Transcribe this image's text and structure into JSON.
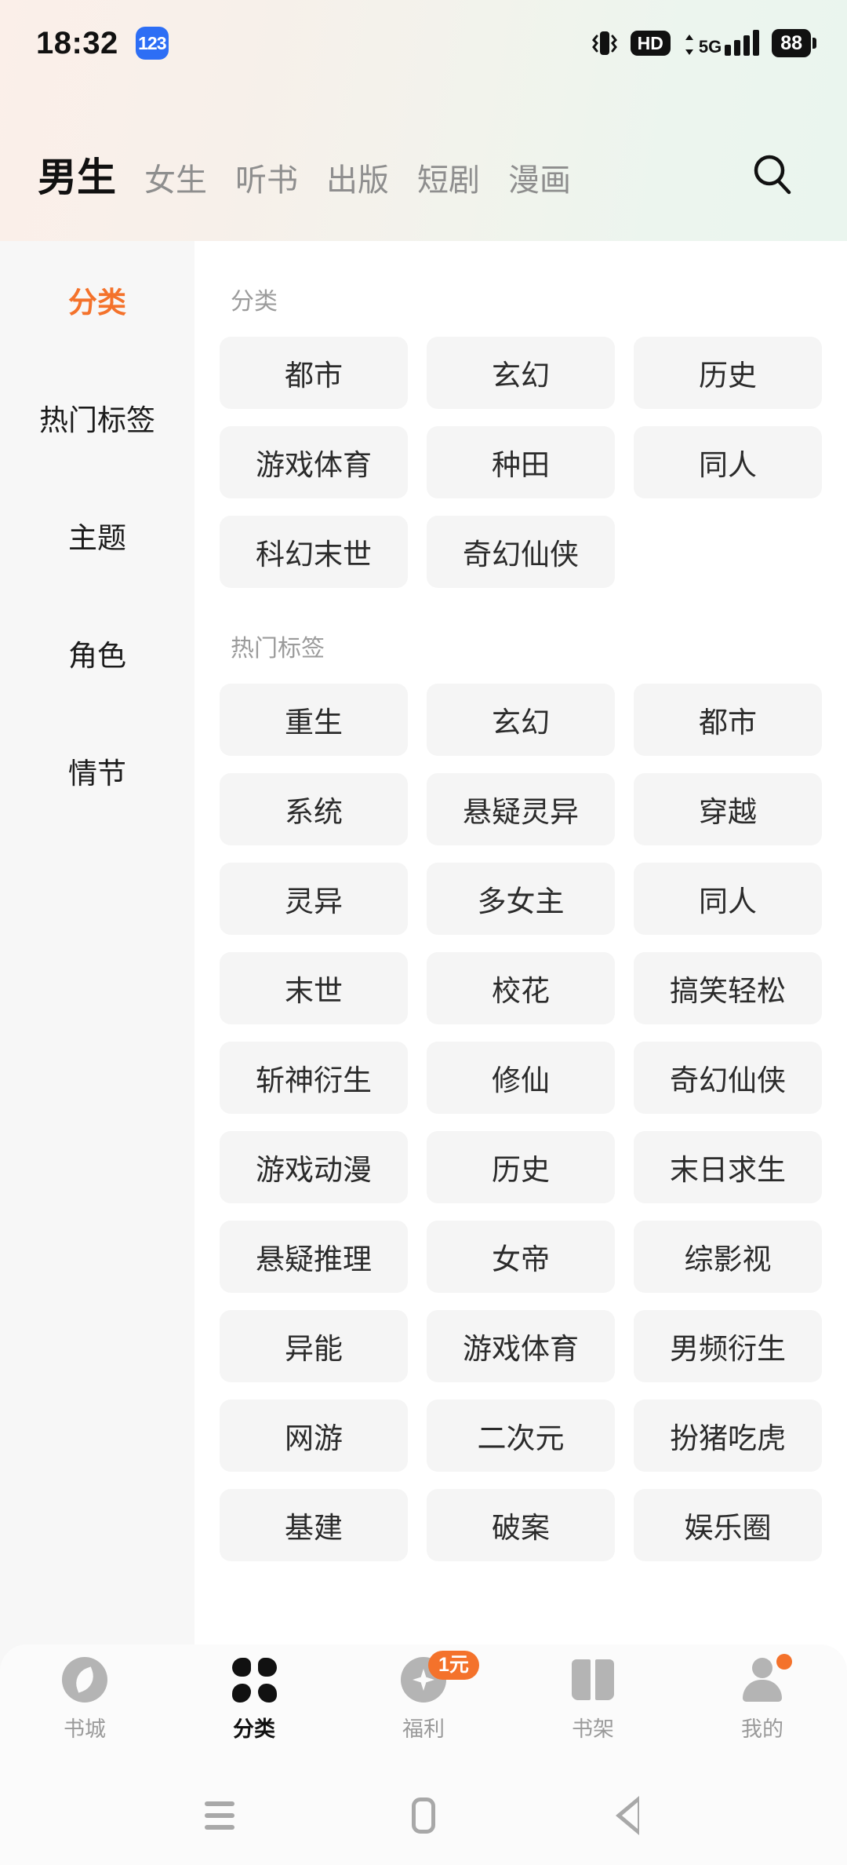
{
  "status_bar": {
    "time": "18:32",
    "app_badge": "123",
    "hd_label": "HD",
    "network_label": "5G",
    "battery_level": "88"
  },
  "top_nav": {
    "tabs": [
      {
        "label": "男生",
        "active": true
      },
      {
        "label": "女生",
        "active": false
      },
      {
        "label": "听书",
        "active": false
      },
      {
        "label": "出版",
        "active": false
      },
      {
        "label": "短剧",
        "active": false
      },
      {
        "label": "漫画",
        "active": false
      }
    ],
    "search_icon": "search-icon"
  },
  "sidebar": {
    "items": [
      {
        "label": "分类",
        "active": true
      },
      {
        "label": "热门标签",
        "active": false
      },
      {
        "label": "主题",
        "active": false
      },
      {
        "label": "角色",
        "active": false
      },
      {
        "label": "情节",
        "active": false
      }
    ]
  },
  "content": {
    "sections": [
      {
        "title": "分类",
        "chips": [
          "都市",
          "玄幻",
          "历史",
          "游戏体育",
          "种田",
          "同人",
          "科幻末世",
          "奇幻仙侠"
        ]
      },
      {
        "title": "热门标签",
        "chips": [
          "重生",
          "玄幻",
          "都市",
          "系统",
          "悬疑灵异",
          "穿越",
          "灵异",
          "多女主",
          "同人",
          "末世",
          "校花",
          "搞笑轻松",
          "斩神衍生",
          "修仙",
          "奇幻仙侠",
          "游戏动漫",
          "历史",
          "末日求生",
          "悬疑推理",
          "女帝",
          "综影视",
          "异能",
          "游戏体育",
          "男频衍生",
          "网游",
          "二次元",
          "扮猪吃虎",
          "基建",
          "破案",
          "娱乐圈"
        ]
      }
    ]
  },
  "bottom_nav": {
    "items": [
      {
        "label": "书城",
        "icon": "compass-icon",
        "active": false,
        "badge": ""
      },
      {
        "label": "分类",
        "icon": "grid-dots-icon",
        "active": true,
        "badge": ""
      },
      {
        "label": "福利",
        "icon": "gift-star-icon",
        "active": false,
        "badge": "1元"
      },
      {
        "label": "书架",
        "icon": "bookshelf-icon",
        "active": false,
        "badge": ""
      },
      {
        "label": "我的",
        "icon": "person-icon",
        "active": false,
        "badge": "dot"
      }
    ]
  },
  "android_nav": {
    "recents": "recents-icon",
    "home": "home-icon",
    "back": "back-icon"
  },
  "colors": {
    "accent": "#f4722b",
    "chip_bg": "#f5f5f5",
    "sidebar_bg": "#f7f7f7",
    "muted_text": "#9b9b9b"
  }
}
